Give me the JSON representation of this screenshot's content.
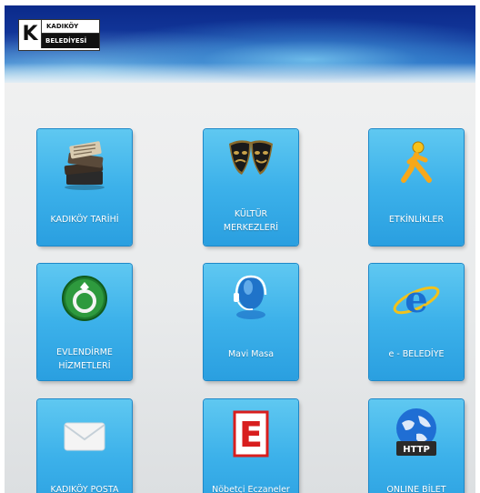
{
  "header": {
    "logo_letter": "K",
    "logo_line1": "KADIKÖY",
    "logo_line2": "BELEDİYESİ"
  },
  "tiles": [
    {
      "label": "KADIKÖY TARİHİ",
      "icon": "newspapers-icon"
    },
    {
      "label": "KÜLTÜR\nMERKEZLERİ",
      "icon": "theater-masks-icon"
    },
    {
      "label": "ETKİNLİKLER",
      "icon": "running-man-icon"
    },
    {
      "label": "EVLENDİRME\nHİZMETLERİ",
      "icon": "wedding-ring-icon"
    },
    {
      "label": "Mavi Masa",
      "icon": "headset-person-icon"
    },
    {
      "label": "e - BELEDİYE",
      "icon": "internet-explorer-icon"
    },
    {
      "label": "KADIKÖY POSTA",
      "icon": "envelope-icon"
    },
    {
      "label": "Nöbetçi Eczaneler",
      "icon": "pharmacy-e-icon"
    },
    {
      "label": "ONLINE BİLET",
      "icon": "globe-http-icon"
    }
  ],
  "icon_badges": {
    "pharmacy_letter": "E",
    "http_text": "HTTP"
  },
  "colors": {
    "tile_blue": "#3cb1ea",
    "banner_blue": "#13389c",
    "pharmacy_red": "#d81e1e"
  }
}
